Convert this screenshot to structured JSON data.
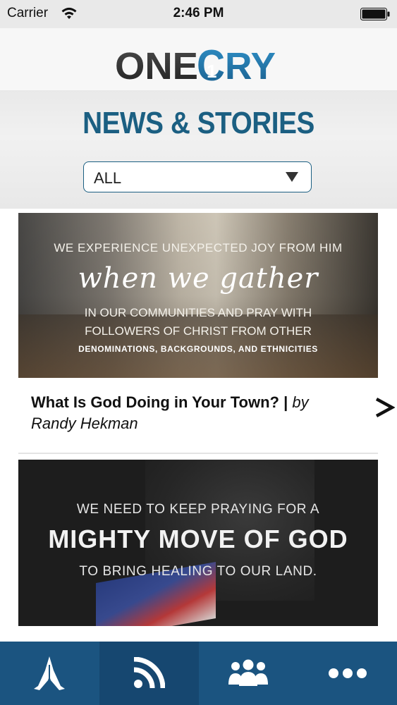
{
  "status_bar": {
    "carrier": "Carrier",
    "time": "2:46 PM"
  },
  "header": {
    "logo_text": "ONECRY"
  },
  "section": {
    "title": "NEWS & STORIES",
    "filter_value": "ALL"
  },
  "stories": [
    {
      "image_lines": [
        "WE EXPERIENCE UNEXPECTED JOY FROM HIM",
        "when we gather",
        "IN OUR COMMUNITIES AND PRAY WITH",
        "FOLLOWERS OF CHRIST FROM OTHER",
        "DENOMINATIONS, BACKGROUNDS, AND ETHNICITIES"
      ],
      "title": "What Is God Doing in Your Town? |",
      "byline": "by Randy Hekman"
    },
    {
      "image_lines": [
        "WE NEED TO KEEP PRAYING FOR A",
        "MIGHTY MOVE OF GOD",
        "TO BRING HEALING TO OUR LAND."
      ]
    }
  ],
  "tab_bar": {
    "tabs": [
      {
        "icon": "praying-hands-icon",
        "active": false
      },
      {
        "icon": "rss-feed-icon",
        "active": true
      },
      {
        "icon": "group-icon",
        "active": false
      },
      {
        "icon": "more-icon",
        "active": false
      }
    ]
  },
  "colors": {
    "brand_blue": "#1b5f82",
    "tab_bar": "#1b5480"
  }
}
